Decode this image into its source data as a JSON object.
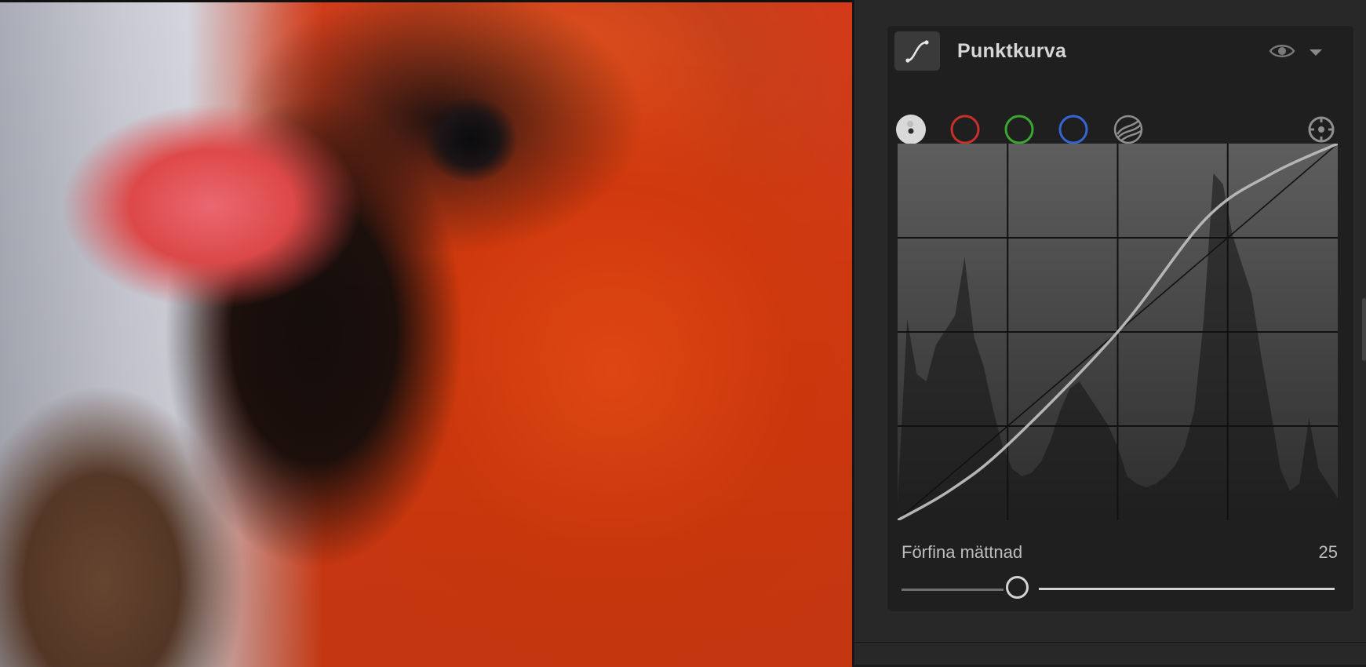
{
  "panel": {
    "title": "Punktkurva",
    "header_icons": [
      "curve-icon",
      "eye-icon",
      "chevron-down-icon"
    ],
    "channels": [
      {
        "name": "luminance",
        "color": "#cfcfcf",
        "selected": true
      },
      {
        "name": "red",
        "color": "#c8302c"
      },
      {
        "name": "green",
        "color": "#3aa830"
      },
      {
        "name": "blue",
        "color": "#3466d6"
      },
      {
        "name": "parametric",
        "color": "#9a9a9a"
      }
    ],
    "target_icon": "target-adjust-icon",
    "refine_saturation": {
      "label": "Förfina mättnad",
      "value": "25",
      "fraction": 0.25
    }
  },
  "curve": {
    "grid_divisions": 4,
    "points": [
      [
        0,
        0
      ],
      [
        0.12,
        0.08
      ],
      [
        0.25,
        0.2
      ],
      [
        0.5,
        0.5
      ],
      [
        0.7,
        0.8
      ],
      [
        0.85,
        0.92
      ],
      [
        1,
        1
      ]
    ],
    "histogram": [
      0.05,
      0.55,
      0.4,
      0.38,
      0.48,
      0.52,
      0.56,
      0.72,
      0.5,
      0.42,
      0.3,
      0.2,
      0.14,
      0.12,
      0.13,
      0.16,
      0.22,
      0.3,
      0.36,
      0.38,
      0.34,
      0.3,
      0.26,
      0.2,
      0.12,
      0.1,
      0.09,
      0.1,
      0.12,
      0.15,
      0.2,
      0.3,
      0.55,
      0.95,
      0.92,
      0.78,
      0.7,
      0.62,
      0.45,
      0.3,
      0.14,
      0.08,
      0.1,
      0.28,
      0.14,
      0.1,
      0.06
    ],
    "colors": {
      "curve": "#b5b5b5",
      "diagonal": "#111111",
      "grid": "#111111"
    }
  }
}
